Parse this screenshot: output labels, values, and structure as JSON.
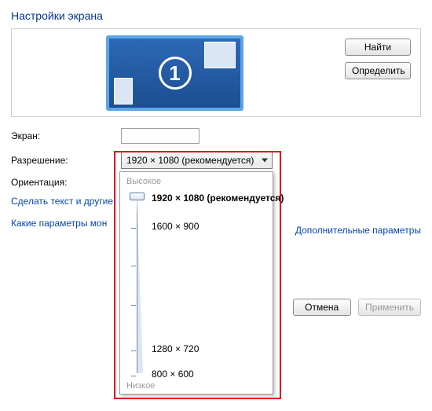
{
  "title": "Настройки экрана",
  "monitor_number": "1",
  "buttons": {
    "find": "Найти",
    "identify": "Определить",
    "cancel": "Отмена",
    "apply": "Применить"
  },
  "labels": {
    "screen": "Экран:",
    "resolution": "Разрешение:",
    "orientation": "Ориентация:"
  },
  "resolution_combo": "1920 × 1080 (рекомендуется)",
  "dropdown": {
    "high": "Высокое",
    "low": "Низкое",
    "options": [
      {
        "text": "1920 × 1080 (рекомендуется)",
        "bold": true,
        "pos": 6
      },
      {
        "text": "1600 × 900",
        "bold": false,
        "pos": 42
      },
      {
        "text": "1280 × 720",
        "bold": false,
        "pos": 198
      },
      {
        "text": "800 × 600",
        "bold": false,
        "pos": 230
      }
    ]
  },
  "links": {
    "text_size": "Сделать текст и другие",
    "which_params": "Какие параметры мон",
    "advanced": "Дополнительные параметры"
  }
}
